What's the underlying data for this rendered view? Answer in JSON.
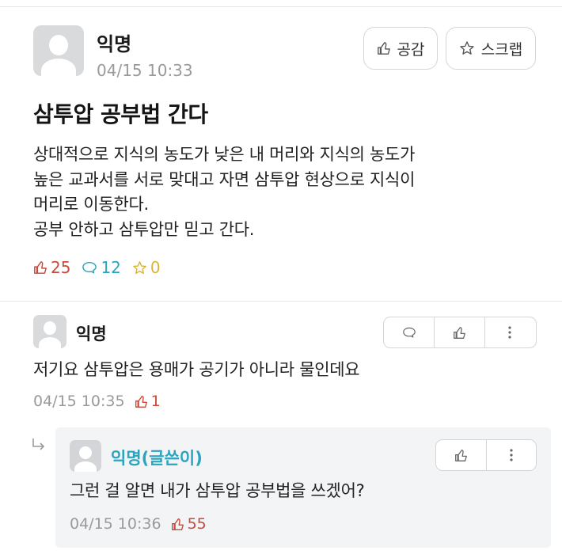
{
  "post": {
    "author": "익명",
    "timestamp": "04/15 10:33",
    "empathy_label": "공감",
    "scrap_label": "스크랩",
    "title": "삼투압 공부법 간다",
    "content_lines": [
      "상대적으로 지식의 농도가 낮은 내 머리와 지식의 농도가",
      "높은 교과서를 서로 맞대고 자면 삼투압 현상으로 지식이",
      "머리로 이동한다.",
      "공부 안하고 삼투압만 믿고 간다."
    ],
    "likes": "25",
    "comments": "12",
    "scraps": "0"
  },
  "comment": {
    "author": "익명",
    "text": "저기요 삼투압은 용매가 공기가 아니라 물인데요",
    "timestamp": "04/15 10:35",
    "likes": "1"
  },
  "reply": {
    "author": "익명(글쓴이)",
    "text": "그런 걸 알면 내가 삼투압 공부법을 쓰겠어?",
    "timestamp": "04/15 10:36",
    "likes": "55"
  },
  "colors": {
    "like": "#c84a3a",
    "comment": "#2aa4bf",
    "scrap": "#d9b43a",
    "op_name": "#2aa4bf",
    "timestamp": "#9a9a9a"
  },
  "icons": [
    "thumbs-up-icon",
    "star-icon",
    "speech-bubble-icon",
    "more-vertical-icon",
    "reply-arrow-icon",
    "avatar-icon"
  ]
}
